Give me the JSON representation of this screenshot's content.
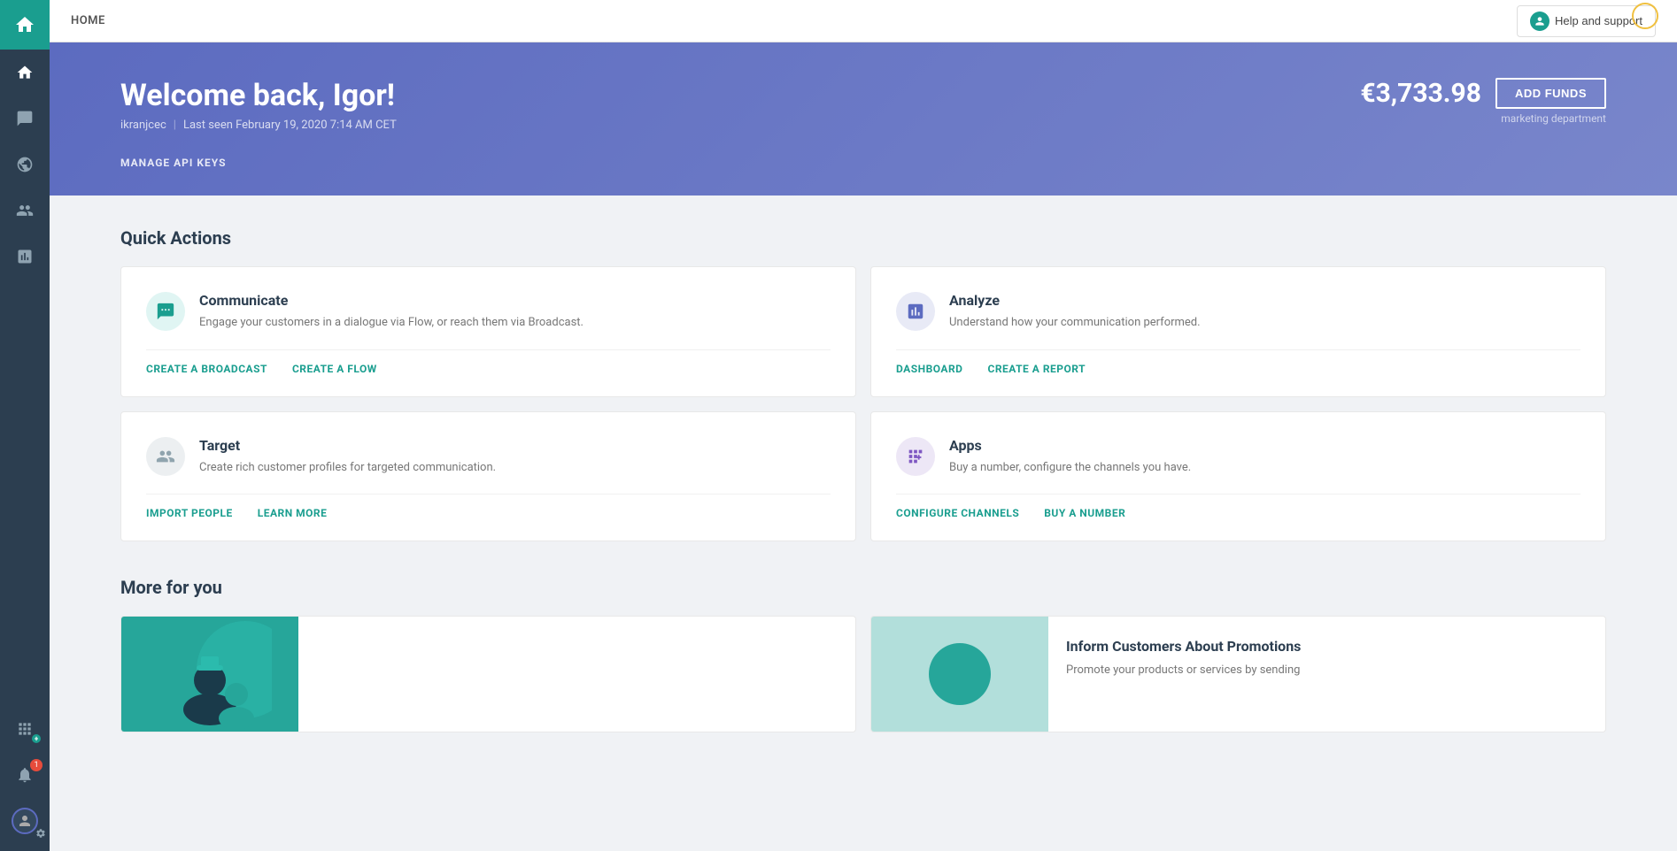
{
  "topbar": {
    "title": "HOME",
    "help_button_label": "Help and support"
  },
  "hero": {
    "welcome": "Welcome back, Igor!",
    "username": "ikranjcec",
    "last_seen": "Last seen February 19, 2020 7:14 AM CET",
    "balance": "€3,733.98",
    "add_funds_label": "ADD FUNDS",
    "department": "marketing department",
    "manage_api_label": "MANAGE API KEYS"
  },
  "quick_actions": {
    "section_title": "Quick Actions",
    "cards": [
      {
        "id": "communicate",
        "title": "Communicate",
        "description": "Engage your customers in a dialogue via Flow, or reach them via Broadcast.",
        "icon": "💬",
        "icon_type": "teal",
        "links": [
          {
            "label": "CREATE A BROADCAST",
            "id": "create-broadcast"
          },
          {
            "label": "CREATE A FLOW",
            "id": "create-flow"
          }
        ]
      },
      {
        "id": "analyze",
        "title": "Analyze",
        "description": "Understand how your communication performed.",
        "icon": "📊",
        "icon_type": "blue",
        "links": [
          {
            "label": "DASHBOARD",
            "id": "dashboard"
          },
          {
            "label": "CREATE A REPORT",
            "id": "create-report"
          }
        ]
      },
      {
        "id": "target",
        "title": "Target",
        "description": "Create rich customer profiles for targeted communication.",
        "icon": "👥",
        "icon_type": "gray",
        "links": [
          {
            "label": "IMPORT PEOPLE",
            "id": "import-people"
          },
          {
            "label": "LEARN MORE",
            "id": "learn-more"
          }
        ]
      },
      {
        "id": "apps",
        "title": "Apps",
        "description": "Buy a number, configure the channels you have.",
        "icon": "⊞",
        "icon_type": "purple",
        "links": [
          {
            "label": "CONFIGURE CHANNELS",
            "id": "configure-channels"
          },
          {
            "label": "BUY A NUMBER",
            "id": "buy-number"
          }
        ]
      }
    ]
  },
  "more_for_you": {
    "section_title": "More for you",
    "cards": [
      {
        "id": "card-left",
        "title": "",
        "description": "",
        "has_image": true,
        "image_type": "teal-person"
      },
      {
        "id": "card-right",
        "title": "Inform Customers About Promotions",
        "description": "Promote your products or services by sending",
        "has_image": true,
        "image_type": "teal-circle"
      }
    ]
  },
  "sidebar": {
    "items": [
      {
        "id": "home",
        "icon": "home",
        "active": true
      },
      {
        "id": "messages",
        "icon": "messages"
      },
      {
        "id": "globe",
        "icon": "globe"
      },
      {
        "id": "people",
        "icon": "people"
      },
      {
        "id": "analytics",
        "icon": "analytics"
      }
    ],
    "bottom_items": [
      {
        "id": "apps-grid",
        "icon": "apps"
      },
      {
        "id": "notifications",
        "icon": "notifications",
        "badge": "1"
      },
      {
        "id": "profile",
        "icon": "profile"
      }
    ]
  }
}
